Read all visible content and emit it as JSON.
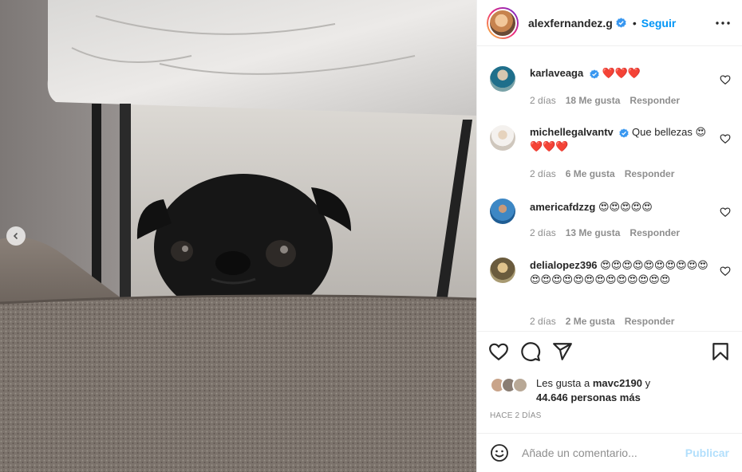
{
  "post": {
    "owner": "alexfernandez.g",
    "separator": "•",
    "follow_label": "Seguir",
    "photo_alt": "",
    "more_icon": "more-horizontal-icon"
  },
  "comments": [
    {
      "user": "karlaveaga",
      "verified": true,
      "text": "❤️❤️❤️",
      "time": "2 días",
      "likes": "18 Me gusta",
      "reply": "Responder"
    },
    {
      "user": "michellegalvantv",
      "verified": true,
      "text": "Que bellezas 😍❤️❤️❤️",
      "time": "2 días",
      "likes": "6 Me gusta",
      "reply": "Responder"
    },
    {
      "user": "americafdzzg",
      "verified": false,
      "text": "😍😍😍😍😍",
      "time": "2 días",
      "likes": "13 Me gusta",
      "reply": "Responder"
    },
    {
      "user": "delialopez396",
      "verified": false,
      "text": "😍😍😍😍😍😍😍😍😍😍😍😍😍😍😍😍😍😍😍😍😍😍😍",
      "time": "2 días",
      "likes": "2 Me gusta",
      "reply": "Responder"
    }
  ],
  "likes": {
    "prefix": "Les gusta a ",
    "user": "mavc2190",
    "conj": " y",
    "others": "44.646 personas más"
  },
  "timestamp": "Hace 2 días",
  "add_comment": {
    "placeholder": "Añade un comentario...",
    "publish_label": "Publicar"
  },
  "colors": {
    "accent": "#0095f6",
    "muted": "#8e8e8e",
    "publish_disabled": "#b2dffc"
  }
}
